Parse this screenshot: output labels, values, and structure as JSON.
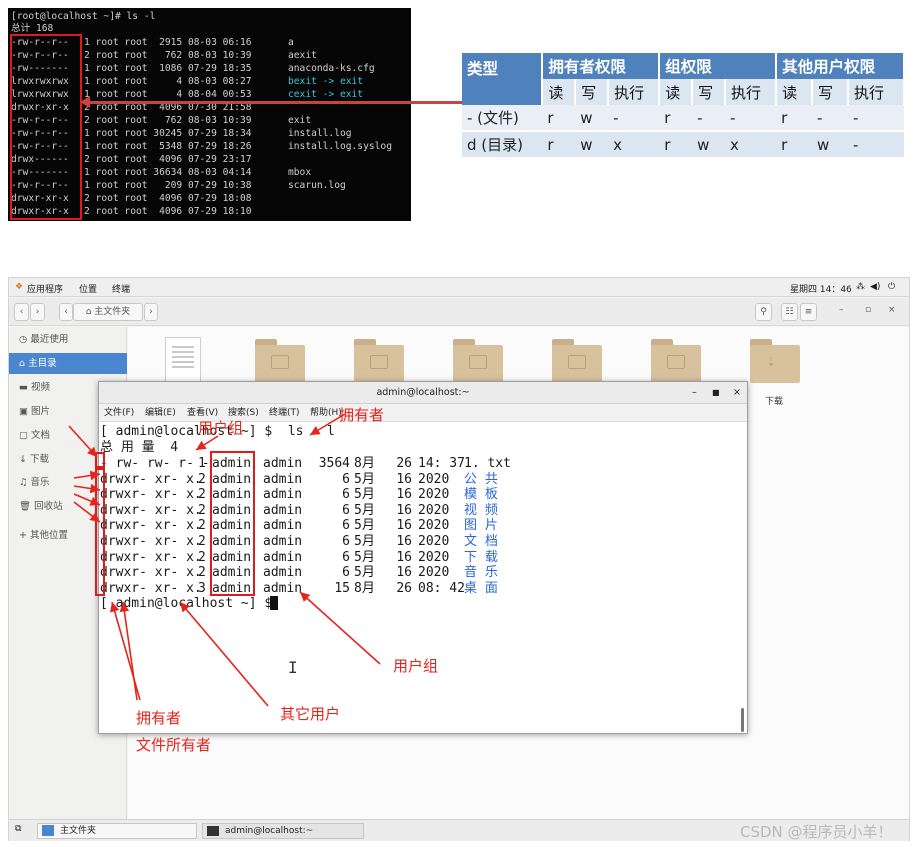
{
  "top_terminal": {
    "prompt": "[root@localhost ~]# ls -l",
    "total": "总计 168",
    "rows": [
      {
        "perm": "-rw-r--r--",
        "rest": "1 root root  2915 08-03 06:16",
        "name": "a",
        "color": "#d0d0d0"
      },
      {
        "perm": "-rw-r--r--",
        "rest": "2 root root   762 08-03 10:39",
        "name": "aexit",
        "color": "#d0d0d0"
      },
      {
        "perm": "-rw-------",
        "rest": "1 root root  1086 07-29 18:35",
        "name": "anaconda-ks.cfg",
        "color": "#d0d0d0"
      },
      {
        "perm": "lrwxrwxrwx",
        "rest": "1 root root     4 08-03 08:27",
        "name": "bexit -> exit",
        "color": "#36c8d8"
      },
      {
        "perm": "lrwxrwxrwx",
        "rest": "1 root root     4 08-04 00:53",
        "name": "cexit -> exit",
        "color": "#36c8d8"
      },
      {
        "perm": "drwxr-xr-x",
        "rest": "2 root root  4096 07-30 21:58",
        "name": "",
        "color": "#404040"
      },
      {
        "perm": "-rw-r--r--",
        "rest": "2 root root   762 08-03 10:39",
        "name": "exit",
        "color": "#d0d0d0"
      },
      {
        "perm": "-rw-r--r--",
        "rest": "1 root root 30245 07-29 18:34",
        "name": "install.log",
        "color": "#d0d0d0"
      },
      {
        "perm": "-rw-r--r--",
        "rest": "1 root root  5348 07-29 18:26",
        "name": "install.log.syslog",
        "color": "#d0d0d0"
      },
      {
        "perm": "drwx------",
        "rest": "2 root root  4096 07-29 23:17",
        "name": "",
        "color": "#2d4fe0"
      },
      {
        "perm": "-rw-------",
        "rest": "1 root root 36634 08-03 04:14",
        "name": "mbox",
        "color": "#d0d0d0"
      },
      {
        "perm": "-rw-r--r--",
        "rest": "1 root root   209 07-29 10:38",
        "name": "scarun.log",
        "color": "#d0d0d0"
      },
      {
        "perm": "drwxr-xr-x",
        "rest": "2 root root  4096 07-29 18:08",
        "name": "",
        "color": "#2d4fe0"
      },
      {
        "perm": "drwxr-xr-x",
        "rest": "2 root root  4096 07-29 18:10",
        "name": "",
        "color": "#2d4fe0"
      }
    ]
  },
  "perm_table": {
    "header": [
      "类型",
      "拥有者权限",
      "组权限",
      "其他用户权限"
    ],
    "sub": [
      "读",
      "写",
      "执行",
      "读",
      "写",
      "执行",
      "读",
      "写",
      "执行"
    ],
    "rows": [
      {
        "type": "- (文件)",
        "cells": [
          "r",
          "w",
          "-",
          "r",
          "-",
          "-",
          "r",
          "-",
          "-"
        ]
      },
      {
        "type": "d (目录)",
        "cells": [
          "r",
          "w",
          "x",
          "r",
          "w",
          "x",
          "r",
          "w",
          "-"
        ]
      }
    ]
  },
  "desktop": {
    "apps_menu": "应用程序",
    "places_menu": "位置",
    "terminal_menu": "终端",
    "clock": "星期四 14：46",
    "path": "主文件夹",
    "sidebar": [
      "最近使用",
      "主目录",
      "视频",
      "图片",
      "文档",
      "下载",
      "音乐",
      "回收站",
      "其他位置"
    ],
    "visible_folder_label": "下载",
    "taskbar": [
      "主文件夹",
      "admin@localhost:~"
    ]
  },
  "terminal": {
    "title": "admin@localhost:~",
    "menu": [
      "文件(F)",
      "编辑(E)",
      "查看(V)",
      "搜索(S)",
      "终端(T)",
      "帮助(H)"
    ],
    "cmd": "[ admin@localhost ~] $  ls - l",
    "total": "总 用 量  4",
    "rows": [
      {
        "perm": "- rw- rw- r- -",
        "n": "1",
        "owner": "admin",
        "group": "admin",
        "size": "3564",
        "month": "8月",
        "day": "26",
        "time": "14: 37",
        "name": "1. txt",
        "dir": false
      },
      {
        "perm": "drwxr- xr- x.",
        "n": "2",
        "owner": "admin",
        "group": "admin",
        "size": "6",
        "month": "5月",
        "day": "16",
        "time": "2020",
        "name": "公 共",
        "dir": true
      },
      {
        "perm": "drwxr- xr- x.",
        "n": "2",
        "owner": "admin",
        "group": "admin",
        "size": "6",
        "month": "5月",
        "day": "16",
        "time": "2020",
        "name": "模 板",
        "dir": true
      },
      {
        "perm": "drwxr- xr- x.",
        "n": "2",
        "owner": "admin",
        "group": "admin",
        "size": "6",
        "month": "5月",
        "day": "16",
        "time": "2020",
        "name": "视 频",
        "dir": true
      },
      {
        "perm": "drwxr- xr- x.",
        "n": "2",
        "owner": "admin",
        "group": "admin",
        "size": "6",
        "month": "5月",
        "day": "16",
        "time": "2020",
        "name": "图 片",
        "dir": true
      },
      {
        "perm": "drwxr- xr- x.",
        "n": "2",
        "owner": "admin",
        "group": "admin",
        "size": "6",
        "month": "5月",
        "day": "16",
        "time": "2020",
        "name": "文 档",
        "dir": true
      },
      {
        "perm": "drwxr- xr- x.",
        "n": "2",
        "owner": "admin",
        "group": "admin",
        "size": "6",
        "month": "5月",
        "day": "16",
        "time": "2020",
        "name": "下 载",
        "dir": true
      },
      {
        "perm": "drwxr- xr- x.",
        "n": "2",
        "owner": "admin",
        "group": "admin",
        "size": "6",
        "month": "5月",
        "day": "16",
        "time": "2020",
        "name": "音 乐",
        "dir": true
      },
      {
        "perm": "drwxr- xr- x.",
        "n": "3",
        "owner": "admin",
        "group": "admin",
        "size": "15",
        "month": "8月",
        "day": "26",
        "time": "08: 42",
        "name": "桌 面",
        "dir": true
      }
    ],
    "prompt": "[ admin@localhost ~] $"
  },
  "annotations": {
    "group_top": "用户组",
    "owner_top": "拥有者",
    "group_bottom": "用户组",
    "others": "其它用户",
    "owner_bottom": "拥有者",
    "file_owner": "文件所有者"
  },
  "watermark": "CSDN @程序员小羊！"
}
